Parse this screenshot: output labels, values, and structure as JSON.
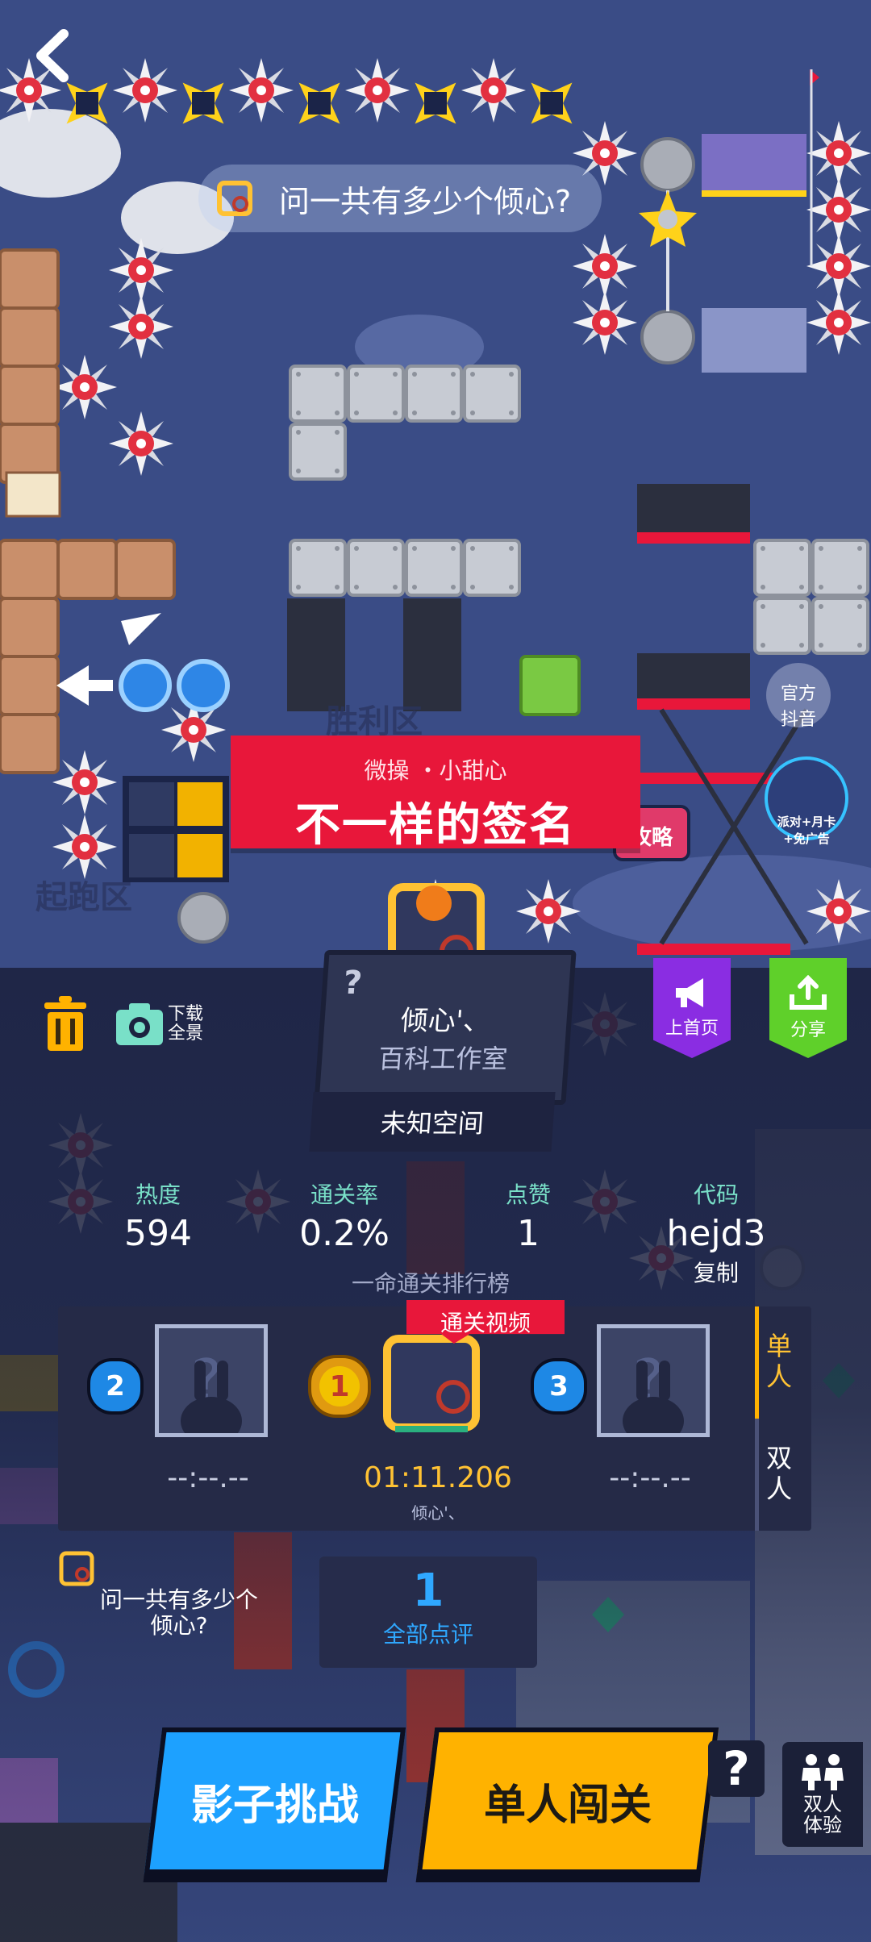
{
  "level": {
    "question": "问一共有多少个倾心?",
    "zone_victory": "胜利区",
    "zone_start": "起跑区",
    "author_line": "微操 ・小甜心",
    "title": "不一样的签名",
    "tv_tag": "攻略",
    "official_tag": "官方\n抖音",
    "promo_tag": "派对+月卡\n+免广告"
  },
  "creator": {
    "name": "倾心'、",
    "studio": "百科工作室",
    "space": "未知空间",
    "help_mark": "?"
  },
  "toolbar": {
    "download_label": "下载\n全景",
    "home_label": "上首页",
    "share_label": "分享"
  },
  "stats": {
    "heat_label": "热度",
    "heat_value": "594",
    "pass_label": "通关率",
    "pass_value": "0.2%",
    "like_label": "点赞",
    "like_value": "1",
    "code_label": "代码",
    "code_value": "hejd3",
    "copy_label": "复制"
  },
  "leaderboard": {
    "title": "一命通关排行榜",
    "video_tag": "通关视频",
    "tab_single": "单人",
    "tab_double": "双人",
    "entries": [
      {
        "rank": "2",
        "time": "--:--.--",
        "name": ""
      },
      {
        "rank": "1",
        "time": "01:11.206",
        "name": "倾心'、"
      },
      {
        "rank": "3",
        "time": "--:--.--",
        "name": ""
      }
    ]
  },
  "bottom": {
    "level_name": "问一共有多少个\n倾心?",
    "review_count": "1",
    "review_label": "全部点评",
    "btn_shadow": "影子挑战",
    "btn_single": "单人闯关",
    "help_mark": "?",
    "double_label": "双人\n体验"
  },
  "colors": {
    "sky": "#3a4c86",
    "panel": "#1c2240",
    "banner_red": "#e8173a",
    "shadow_btn": "#1da1ff",
    "single_btn": "#ffb200",
    "stat_label": "#79e0c8",
    "gold_time": "#ffc233"
  }
}
